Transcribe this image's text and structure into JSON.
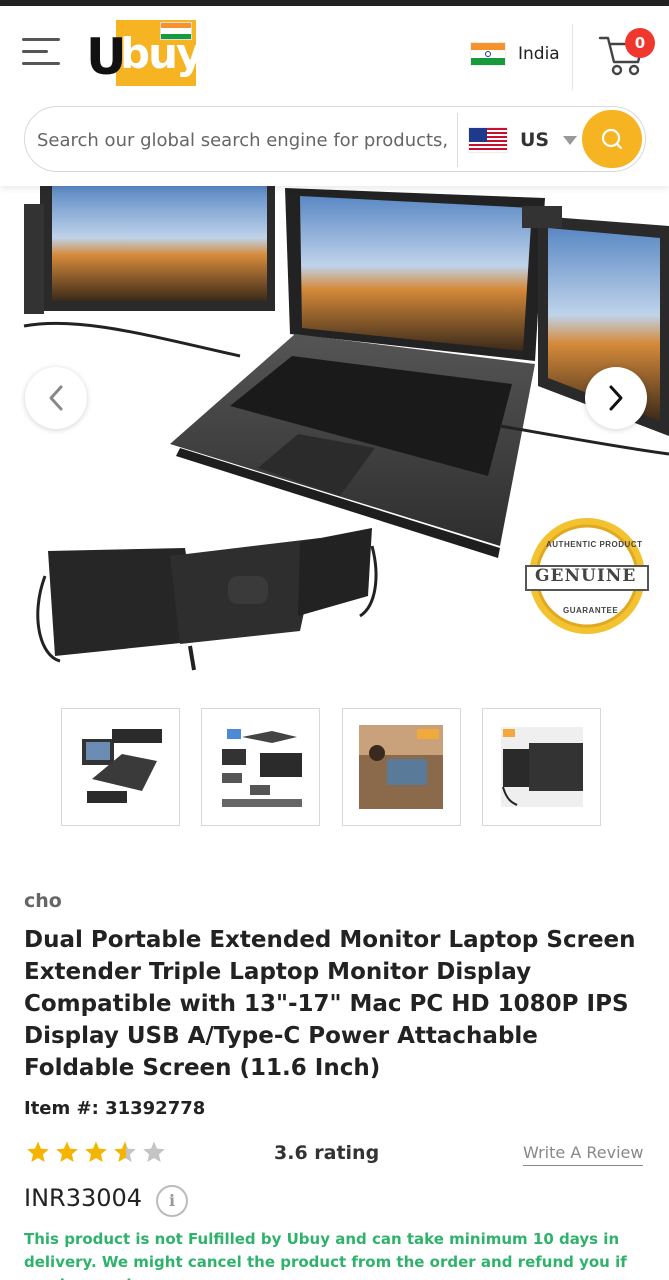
{
  "header": {
    "logo_text_u": "U",
    "logo_text_buy": "buy",
    "country": "India",
    "cart_count": "0",
    "menu_icon": "hamburger-menu-icon",
    "cart_icon": "shopping-cart-icon"
  },
  "search": {
    "placeholder": "Search our global search engine for products, categories, brands",
    "store": "US",
    "button_icon": "search-icon"
  },
  "gallery": {
    "prev_icon": "chevron-left-icon",
    "next_icon": "chevron-right-icon",
    "badge_top": "AUTHENTIC PRODUCT",
    "badge_main": "GENUINE",
    "badge_bottom": "GUARANTEE",
    "thumb_count": 4
  },
  "product": {
    "brand": "cho",
    "title": "Dual Portable Extended Monitor Laptop Screen Extender Triple Laptop Monitor Display Compatible with 13\"-17\" Mac PC HD 1080P IPS Display USB A/Type-C Power Attachable Foldable Screen (11.6 Inch)",
    "item_number": "Item #: 31392778",
    "stars": 3.6,
    "rating_text": "3.6 rating",
    "write_review": "Write A Review",
    "price": "INR33004",
    "info_icon_text": "i",
    "fulfillment_notice": "This product is not Fulfilled by Ubuy and can take minimum 10 days in delivery. We might cancel the product from the order and refund you if any issue arise"
  },
  "colors": {
    "accent": "#f6b322",
    "badge_red": "#f0372e",
    "notice_green": "#2fb36c",
    "star_gold": "#f5b400",
    "star_grey": "#c4c4c4"
  }
}
